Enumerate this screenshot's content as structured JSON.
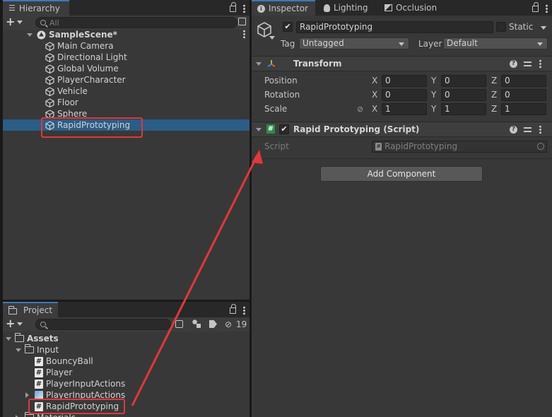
{
  "hierarchy": {
    "tab_label": "Hierarchy",
    "search_placeholder": "All",
    "scene": "SampleScene*",
    "items": [
      "Main Camera",
      "Directional Light",
      "Global Volume",
      "PlayerCharacter",
      "Vehicle",
      "Floor",
      "Sphere",
      "RapidPrototyping"
    ],
    "selected_index": 7
  },
  "project": {
    "tab_label": "Project",
    "hidden_count": "19",
    "items": [
      {
        "label": "Assets",
        "type": "folder"
      },
      {
        "label": "Input",
        "type": "folder"
      },
      {
        "label": "BouncyBall",
        "type": "script"
      },
      {
        "label": "Player",
        "type": "script"
      },
      {
        "label": "PlayerInputActions",
        "type": "script"
      },
      {
        "label": "PlayerInputActions",
        "type": "asset"
      },
      {
        "label": "RapidPrototyping",
        "type": "script"
      },
      {
        "label": "Materials",
        "type": "folder"
      }
    ]
  },
  "inspector": {
    "tabs": [
      "Inspector",
      "Lighting",
      "Occlusion"
    ],
    "object_name": "RapidPrototyping",
    "static_label": "Static",
    "tag_label": "Tag",
    "tag_value": "Untagged",
    "layer_label": "Layer",
    "layer_value": "Default",
    "transform": {
      "title": "Transform",
      "rows": [
        {
          "label": "Position",
          "x": "0",
          "y": "0",
          "z": "0"
        },
        {
          "label": "Rotation",
          "x": "0",
          "y": "0",
          "z": "0"
        },
        {
          "label": "Scale",
          "x": "1",
          "y": "1",
          "z": "1"
        }
      ],
      "axis_x": "X",
      "axis_y": "Y",
      "axis_z": "Z"
    },
    "script_component": {
      "title": "Rapid Prototyping (Script)",
      "script_label": "Script",
      "script_value": "RapidPrototyping"
    },
    "add_component_label": "Add Component"
  },
  "colors": {
    "selection": "#2c5d87",
    "highlight": "#e0383a",
    "panel": "#383838"
  }
}
